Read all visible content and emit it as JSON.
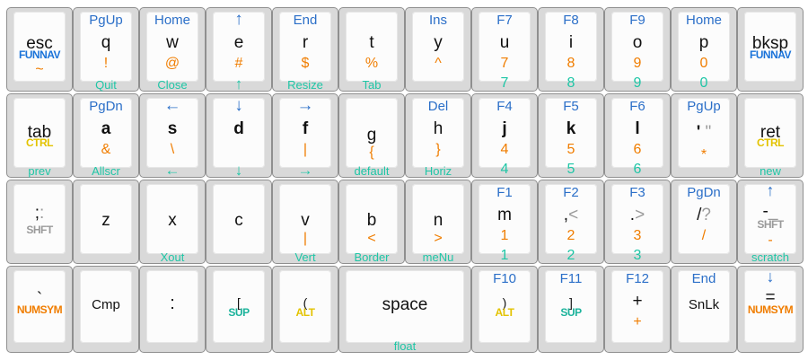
{
  "colors": {
    "key_body": "#d9d9d9",
    "keycap": "#fcfcfc",
    "nav_blue": "#2b6fc8",
    "symbol_orange": "#f07d00",
    "number_teal": "#1fc6a6",
    "mod_yellow": "#e3c300",
    "mod_gray": "#9a9a9a"
  },
  "keys": {
    "esc": {
      "main": "esc",
      "hold": "FUNNAV",
      "lower": "~"
    },
    "q": {
      "top": "PgUp",
      "main": "q",
      "lower": "!",
      "front": "Quit"
    },
    "w": {
      "top": "Home",
      "main": "w",
      "lower": "@",
      "front": "Close"
    },
    "e": {
      "top": "↑",
      "main": "e",
      "lower": "#",
      "front": "↑"
    },
    "r": {
      "top": "End",
      "main": "r",
      "lower": "$",
      "front": "Resize"
    },
    "t": {
      "main": "t",
      "lower": "%",
      "front": "Tab"
    },
    "y": {
      "top": "Ins",
      "main": "y",
      "lower": "^"
    },
    "u": {
      "top": "F7",
      "main": "u",
      "lower": "7",
      "front": "7"
    },
    "i": {
      "top": "F8",
      "main": "i",
      "lower": "8",
      "front": "8"
    },
    "o": {
      "top": "F9",
      "main": "o",
      "lower": "9",
      "front": "9"
    },
    "p": {
      "top": "Home",
      "main": "p",
      "lower": "0",
      "front": "0"
    },
    "bksp": {
      "main": "bksp",
      "hold": "FUNNAV"
    },
    "tab": {
      "main": "tab",
      "hold": "CTRL",
      "front": "prev"
    },
    "a": {
      "top": "PgDn",
      "main": "a",
      "lower": "&",
      "front": "Allscr"
    },
    "s": {
      "top": "←",
      "main": "s",
      "lower": "\\",
      "front": "←"
    },
    "d": {
      "top": "↓",
      "main": "d",
      "front": "↓"
    },
    "f": {
      "top": "→",
      "main": "f",
      "lower": "|",
      "front": "→"
    },
    "g": {
      "main": "g",
      "lower": "{",
      "front": "default"
    },
    "h": {
      "top": "Del",
      "main": "h",
      "lower": "}",
      "front": "Horiz"
    },
    "j": {
      "top": "F4",
      "main": "j",
      "lower": "4",
      "front": "4"
    },
    "k": {
      "top": "F5",
      "main": "k",
      "lower": "5",
      "front": "5"
    },
    "l": {
      "top": "F6",
      "main": "l",
      "lower": "6",
      "front": "6"
    },
    "quote": {
      "top": "PgUp",
      "main": "'",
      "main_shift": "\"",
      "lower": "*"
    },
    "ret": {
      "main": "ret",
      "hold": "CTRL",
      "front": "new"
    },
    "semicolon": {
      "main": ";",
      "main_shift": ":",
      "hold": "SHFT"
    },
    "z": {
      "main": "z"
    },
    "x": {
      "main": "x",
      "front": "Xout"
    },
    "c": {
      "main": "c"
    },
    "v": {
      "main": "v",
      "lower": "|",
      "front": "Vert"
    },
    "b": {
      "main": "b",
      "lower": "<",
      "front": "Border"
    },
    "n": {
      "main": "n",
      "lower": ">",
      "front": "meNu"
    },
    "m": {
      "top": "F1",
      "main": "m",
      "lower": "1",
      "front": "1"
    },
    "comma": {
      "top": "F2",
      "main": ",",
      "main_shift": "<",
      "lower": "2",
      "front": "2"
    },
    "period": {
      "top": "F3",
      "main": ".",
      "main_shift": ">",
      "lower": "3",
      "front": "3"
    },
    "slash": {
      "top": "PgDn",
      "main": "/",
      "main_shift": "?",
      "lower": "/"
    },
    "minus": {
      "top": "↑",
      "main": "-",
      "main_shift": "_",
      "hold": "SHFT",
      "lower": "-",
      "front": "scratch"
    },
    "grave": {
      "main": "`",
      "hold": "NUMSYM"
    },
    "cmp": {
      "main": "Cmp"
    },
    "colon": {
      "main": ":"
    },
    "lbracket": {
      "main": "[",
      "hold": "SUP"
    },
    "lparen": {
      "main": "(",
      "hold": "ALT"
    },
    "space": {
      "main": "space",
      "front": "float"
    },
    "rparen": {
      "top": "F10",
      "main": ")",
      "hold": "ALT"
    },
    "rbracket": {
      "top": "F11",
      "main": "]",
      "hold": "SUP"
    },
    "plus": {
      "top": "F12",
      "main": "+",
      "lower": "+"
    },
    "end": {
      "top": "End",
      "main": "SnLk"
    },
    "equals": {
      "top": "↓",
      "main": "=",
      "hold": "NUMSYM"
    }
  }
}
